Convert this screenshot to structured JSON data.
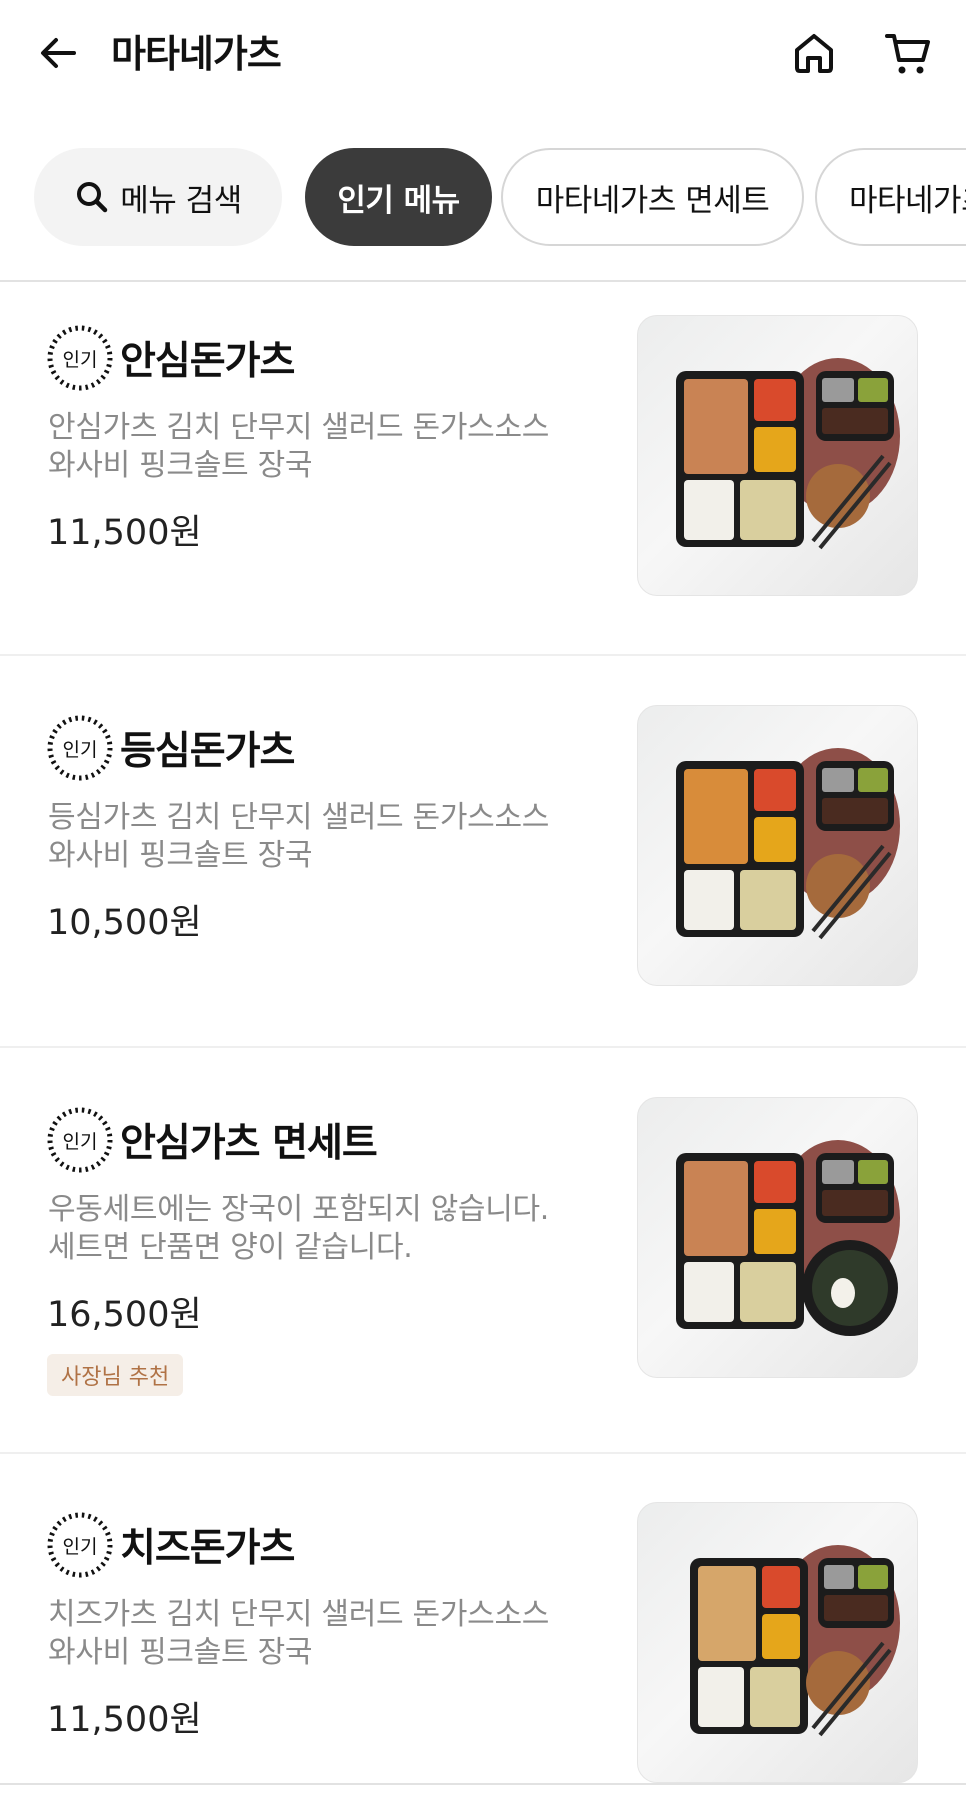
{
  "header": {
    "title": "마타네가츠"
  },
  "chips": {
    "search_label": "메뉴 검색",
    "popular_label": "인기 메뉴",
    "set_label": "마타네가츠 면세트",
    "more_label": "마타네가츠"
  },
  "badge_text": "인기",
  "items": [
    {
      "name": "안심돈가츠",
      "desc_line1": "안심가츠 김치 단무지 샐러드 돈가스소스",
      "desc_line2": "와사비 핑크솔트 장국",
      "price": "11,500원"
    },
    {
      "name": "등심돈가츠",
      "desc_line1": "등심가츠 김치 단무지 샐러드 돈가스소스",
      "desc_line2": "와사비 핑크솔트 장국",
      "price": "10,500원"
    },
    {
      "name": "안심가츠 면세트",
      "desc_line1": "우동세트에는 장국이 포함되지 않습니다.",
      "desc_line2": "세트면 단품면 양이 같습니다.",
      "price": "16,500원",
      "tag": "사장님 추천"
    },
    {
      "name": "치즈돈가츠",
      "desc_line1": "치즈가츠 김치 단무지 샐러드 돈가스소스",
      "desc_line2": "와사비 핑크솔트 장국",
      "price": "11,500원"
    }
  ],
  "colors": {
    "accent_dark": "#3b3b3b",
    "desc_gray": "#8a8a8a",
    "tag_bg": "#f5eee7",
    "tag_text": "#b07245"
  }
}
